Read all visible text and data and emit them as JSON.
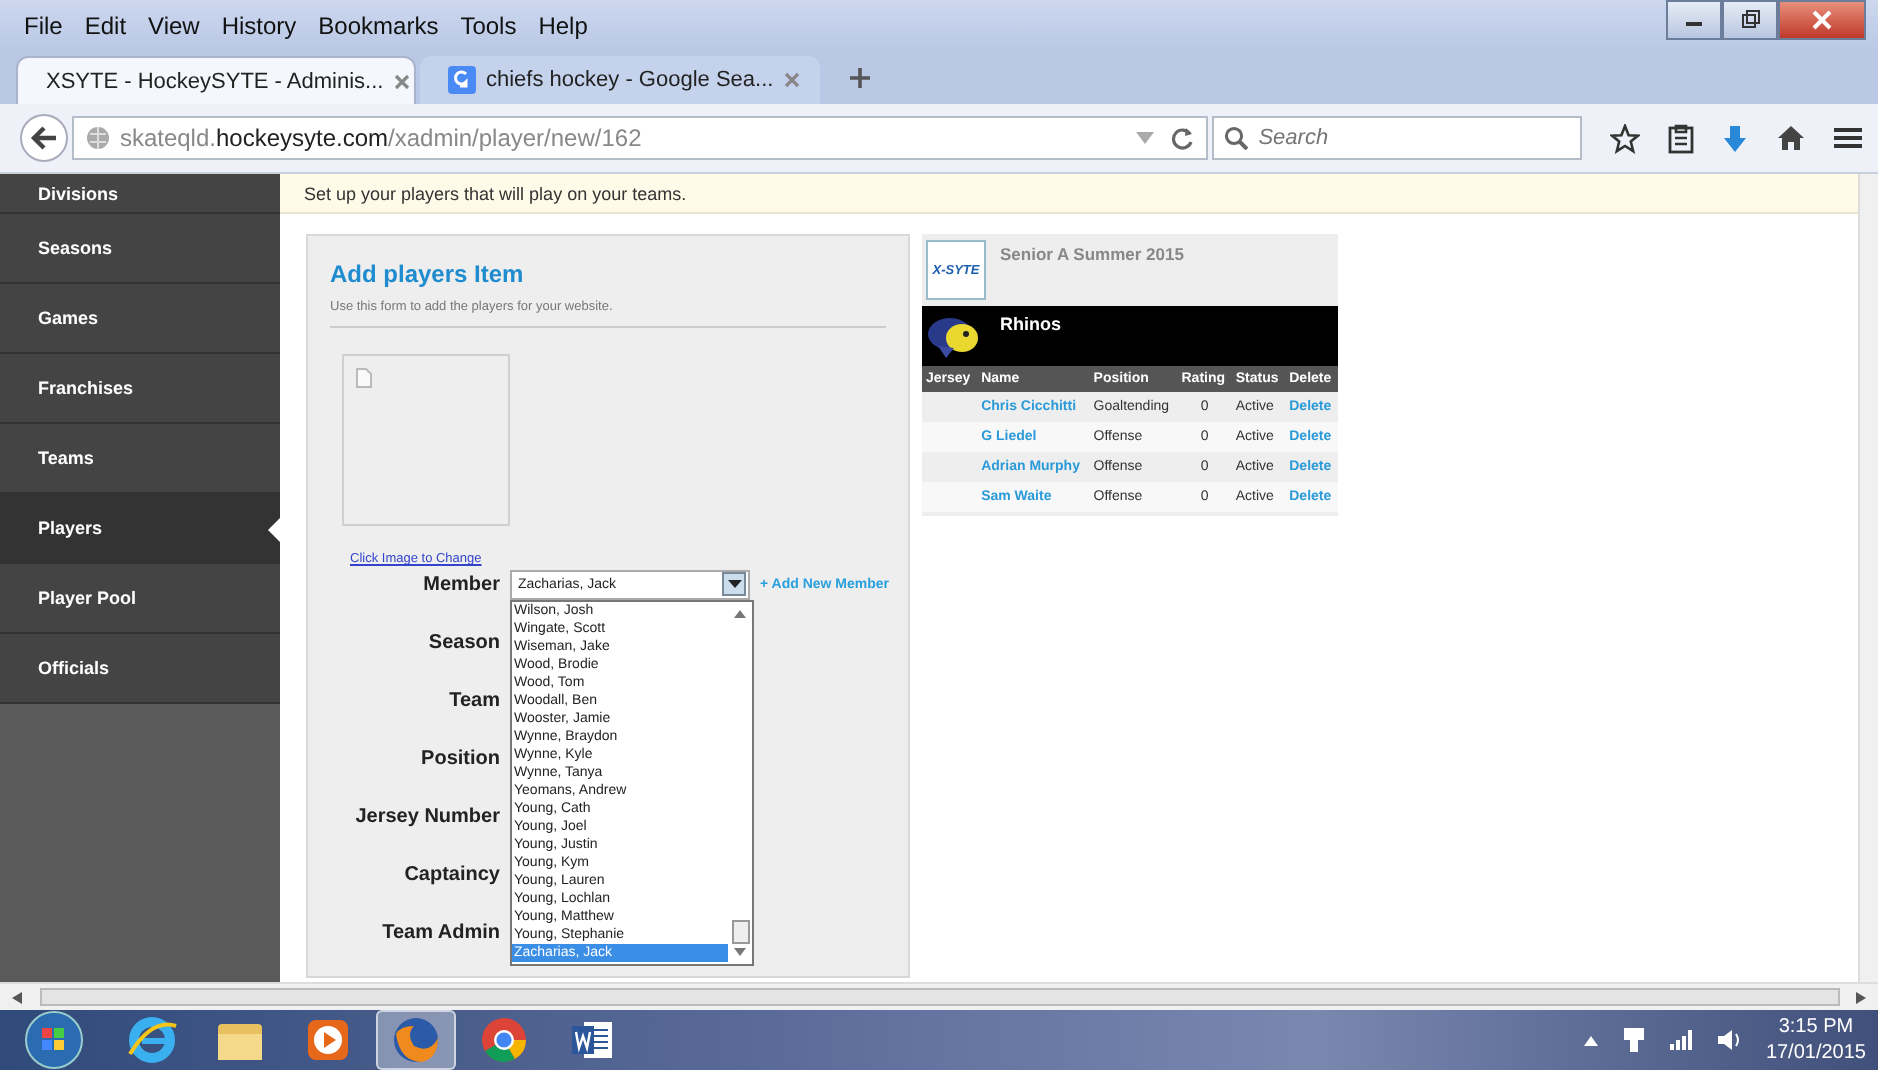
{
  "menu_bar": [
    "File",
    "Edit",
    "View",
    "History",
    "Bookmarks",
    "Tools",
    "Help"
  ],
  "tabs": [
    {
      "label": "XSYTE - HockeySYTE - Adminis...",
      "selected": true,
      "kind": "site"
    },
    {
      "label": "chiefs hockey - Google Sea...",
      "selected": false,
      "kind": "search"
    }
  ],
  "address_bar": {
    "url": "skateqld.**hockeysyte.com**/xadmin/player/new/162"
  },
  "search": {
    "placeholder": "Search"
  },
  "sidebar": {
    "items": [
      {
        "label": "Divisions",
        "selected": false
      },
      {
        "label": "Seasons",
        "selected": false
      },
      {
        "label": "Games",
        "selected": false
      },
      {
        "label": "Franchises",
        "selected": false
      },
      {
        "label": "Teams",
        "selected": false
      },
      {
        "label": "Players",
        "selected": true
      },
      {
        "label": "Player Pool",
        "selected": false
      },
      {
        "label": "Officials",
        "selected": false
      }
    ]
  },
  "banner": "Set up your players that will play on your teams.",
  "form": {
    "title": "Add players Item",
    "description": "Use this form to add the players for your website.",
    "image_link": "Click Image to Change",
    "fields": [
      {
        "label": "Member",
        "value": "Zacharias, Jack",
        "link": "+ Add New Member"
      },
      {
        "label": "Season"
      },
      {
        "label": "Team"
      },
      {
        "label": "Position"
      },
      {
        "label": "Jersey Number"
      },
      {
        "label": "Captaincy"
      },
      {
        "label": "Team Admin"
      }
    ],
    "member_options": [
      {
        "label": "Wilson, Josh",
        "selected": false
      },
      {
        "label": "Wingate, Scott",
        "selected": false
      },
      {
        "label": "Wiseman, Jake",
        "selected": false
      },
      {
        "label": "Wood, Brodie",
        "selected": false
      },
      {
        "label": "Wood, Tom",
        "selected": false
      },
      {
        "label": "Woodall, Ben",
        "selected": false
      },
      {
        "label": "Wooster, Jamie",
        "selected": false
      },
      {
        "label": "Wynne, Braydon",
        "selected": false
      },
      {
        "label": "Wynne, Kyle",
        "selected": false
      },
      {
        "label": "Wynne, Tanya",
        "selected": false
      },
      {
        "label": "Yeomans, Andrew",
        "selected": false
      },
      {
        "label": "Young, Cath",
        "selected": false
      },
      {
        "label": "Young, Joel",
        "selected": false
      },
      {
        "label": "Young, Justin",
        "selected": false
      },
      {
        "label": "Young, Kym",
        "selected": false
      },
      {
        "label": "Young, Lauren",
        "selected": false
      },
      {
        "label": "Young, Lochlan",
        "selected": false
      },
      {
        "label": "Young, Matthew",
        "selected": false
      },
      {
        "label": "Young, Stephanie",
        "selected": false
      },
      {
        "label": "Zacharias, Jack",
        "selected": true
      }
    ]
  },
  "team_panel": {
    "logo": "X-SYTE",
    "season": "Senior A Summer 2015",
    "team": "Rhinos",
    "columns": [
      "Jersey",
      "Name",
      "Position",
      "Rating",
      "Status",
      "Delete"
    ],
    "rows": [
      {
        "name": "Chris Cicchitti",
        "position": "Goaltending",
        "rating": "0",
        "status": "Active",
        "action": "Delete"
      },
      {
        "name": "G Liedel",
        "position": "Offense",
        "rating": "0",
        "status": "Active",
        "action": "Delete"
      },
      {
        "name": "Adrian Murphy",
        "position": "Offense",
        "rating": "0",
        "status": "Active",
        "action": "Delete"
      },
      {
        "name": "Sam Waite",
        "position": "Offense",
        "rating": "0",
        "status": "Active",
        "action": "Delete"
      }
    ]
  },
  "taskbar": {
    "apps": [
      {
        "kind": "ie",
        "selected": false
      },
      {
        "kind": "folder",
        "selected": false
      },
      {
        "kind": "media",
        "selected": false
      },
      {
        "kind": "firefox",
        "selected": true
      },
      {
        "kind": "chrome",
        "selected": false
      },
      {
        "kind": "word",
        "selected": false
      }
    ],
    "time": "3:15 PM",
    "date": "17/01/2015"
  }
}
